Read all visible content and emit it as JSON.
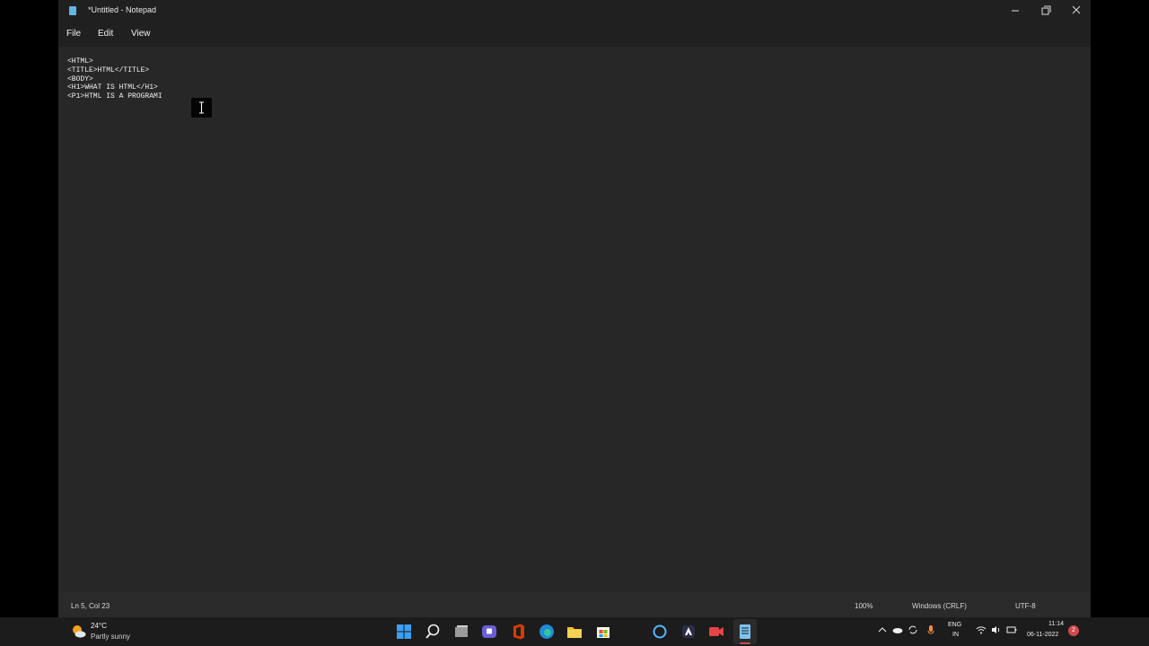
{
  "window": {
    "title": "*Untitled - Notepad",
    "icon": "notepad-icon",
    "controls": [
      "minimize-icon",
      "restore-icon",
      "close-icon"
    ]
  },
  "menu": {
    "file": "File",
    "edit": "Edit",
    "view": "View",
    "settings_icon": "gear-icon"
  },
  "editor": {
    "content": "<HTML>\n<TITLE>HTML</TITLE>\n<BODY>\n<H1>WHAT IS HTML</H1>\n<P1>HTML IS A PROGRAMI"
  },
  "status": {
    "position": "Ln 5, Col 23",
    "zoom": "100%",
    "line_ending": "Windows (CRLF)",
    "encoding": "UTF-8"
  },
  "taskbar": {
    "weather": {
      "temp": "24°C",
      "condition": "Partly sunny",
      "icon": "sun-cloud-icon"
    },
    "apps": [
      "start-icon",
      "search-icon",
      "task-view-icon",
      "teams-icon",
      "office-icon",
      "edge-icon",
      "file-explorer-icon",
      "store-icon",
      "cortana-icon",
      "creative-app-icon",
      "video-app-icon",
      "notepad-icon"
    ],
    "language": {
      "line1": "ENG",
      "line2": "IN"
    },
    "clock": {
      "time": "11:14",
      "date": "06-11-2022"
    },
    "notifications": "2"
  },
  "colors": {
    "window_bg": "#272727",
    "titlebar_bg": "#202020",
    "taskbar_bg": "#1c1c1c",
    "accent": "#62b6e6"
  }
}
